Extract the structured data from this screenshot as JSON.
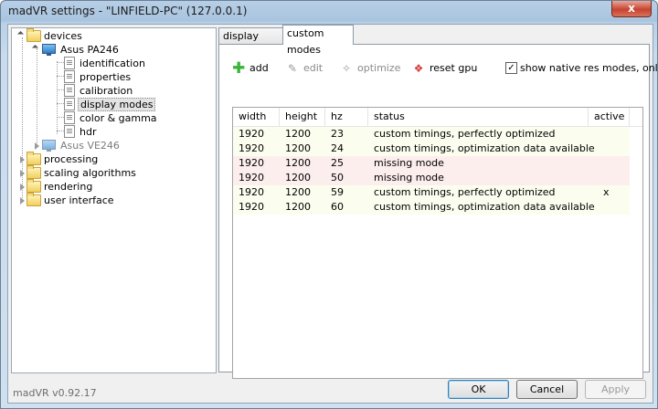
{
  "window": {
    "title": "madVR settings - \"LINFIELD-PC\" (127.0.0.1)",
    "close_glyph": "x"
  },
  "tree": {
    "devices": "devices",
    "device1": "Asus PA246",
    "children": [
      "identification",
      "properties",
      "calibration",
      "display modes",
      "color & gamma",
      "hdr"
    ],
    "device2": "Asus VE246",
    "sections": [
      "processing",
      "scaling algorithms",
      "rendering",
      "user interface"
    ]
  },
  "tabs": [
    "display modes",
    "custom modes"
  ],
  "toolbar": {
    "add": "add",
    "edit": "edit",
    "optimize": "optimize",
    "reset_gpu": "reset gpu",
    "native_res_label": "show native res modes, only",
    "native_res_checked": true
  },
  "table": {
    "columns": [
      "width",
      "height",
      "hz",
      "status",
      "active"
    ],
    "rows": [
      {
        "width": "1920",
        "height": "1200",
        "hz": "23",
        "status": "custom timings, perfectly optimized",
        "active": "",
        "tone": "ok"
      },
      {
        "width": "1920",
        "height": "1200",
        "hz": "24",
        "status": "custom timings, optimization data available",
        "active": "",
        "tone": "ok"
      },
      {
        "width": "1920",
        "height": "1200",
        "hz": "25",
        "status": "missing mode",
        "active": "",
        "tone": "missing"
      },
      {
        "width": "1920",
        "height": "1200",
        "hz": "50",
        "status": "missing mode",
        "active": "",
        "tone": "missing"
      },
      {
        "width": "1920",
        "height": "1200",
        "hz": "59",
        "status": "custom timings, perfectly optimized",
        "active": "x",
        "tone": "ok"
      },
      {
        "width": "1920",
        "height": "1200",
        "hz": "60",
        "status": "custom timings, optimization data available",
        "active": "",
        "tone": "ok"
      }
    ]
  },
  "colors": {
    "row_ok": "#fbfdef",
    "row_missing": "#fdeeee",
    "add_icon": "#3bb33b",
    "reset_icon": "#d23b3b"
  },
  "footer": {
    "version": "madVR v0.92.17",
    "ok": "OK",
    "cancel": "Cancel",
    "apply": "Apply"
  }
}
